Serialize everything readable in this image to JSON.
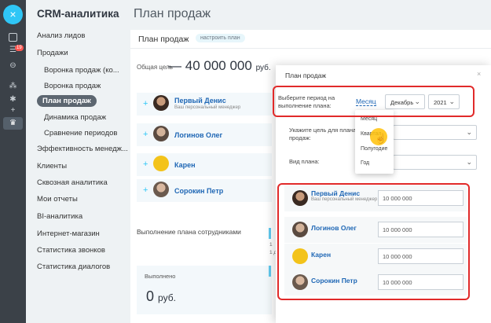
{
  "rail": {
    "close_glyph": "×",
    "badge": "19"
  },
  "menu": {
    "app_title": "CRM-аналитика",
    "items": [
      {
        "label": "Анализ лидов"
      },
      {
        "label": "Продажи"
      },
      {
        "label": "Воронка продаж (ко..."
      },
      {
        "label": "Воронка продаж"
      },
      {
        "label": "План продаж"
      },
      {
        "label": "Динамика продаж"
      },
      {
        "label": "Сравнение периодов"
      },
      {
        "label": "Эффективность менедж..."
      },
      {
        "label": "Клиенты"
      },
      {
        "label": "Сквозная аналитика"
      },
      {
        "label": "Мои отчеты"
      },
      {
        "label": "BI-аналитика"
      },
      {
        "label": "Интернет-магазин"
      },
      {
        "label": "Статистика звонков"
      },
      {
        "label": "Статистика диалогов"
      }
    ]
  },
  "page": {
    "title": "План продаж"
  },
  "card": {
    "title": "План продаж",
    "setup_button": "настроить план",
    "goal_label": "Общая цель",
    "goal_value": "40 000 000",
    "goal_unit": "руб.",
    "employees": [
      {
        "name": "Первый Денис",
        "subtitle": "Ваш персональный менеджер"
      },
      {
        "name": "Логинов Олег",
        "subtitle": ""
      },
      {
        "name": "Карен",
        "subtitle": ""
      },
      {
        "name": "Сорокин Петр",
        "subtitle": ""
      }
    ],
    "employees_total_label": "Выполнение плана сотрудниками",
    "done_label": "Выполнено",
    "done_value": "0",
    "done_unit": "руб.",
    "cut_texts": [
      "1",
      "1 д"
    ]
  },
  "dialog": {
    "title": "План продаж",
    "close_glyph": "×",
    "period_label_line1": "Выберите период на",
    "period_label_line2": "выполнение плана:",
    "period_link": "Месяц",
    "month_select": "Декабрь",
    "year_select": "2021",
    "goal_label_line1": "Укажите цель для плана",
    "goal_label_line2": "продаж:",
    "type_label": "Вид плана:",
    "dropdown_options": [
      "Месяц",
      "Квартал",
      "Полугодие",
      "Год"
    ],
    "rows": [
      {
        "name": "Первый Денис",
        "subtitle": "Ваш персональный менеджер",
        "value": "10 000 000"
      },
      {
        "name": "Логинов Олег",
        "subtitle": "",
        "value": "10 000 000"
      },
      {
        "name": "Карен",
        "subtitle": "",
        "value": "10 000 000"
      },
      {
        "name": "Сорокин Петр",
        "subtitle": "",
        "value": "10 000 000"
      }
    ]
  },
  "colors": {
    "accent": "#2fc6f6",
    "link": "#1f67b5",
    "highlight_box": "#e12a2a",
    "cursor_highlight": "#ffc107"
  }
}
